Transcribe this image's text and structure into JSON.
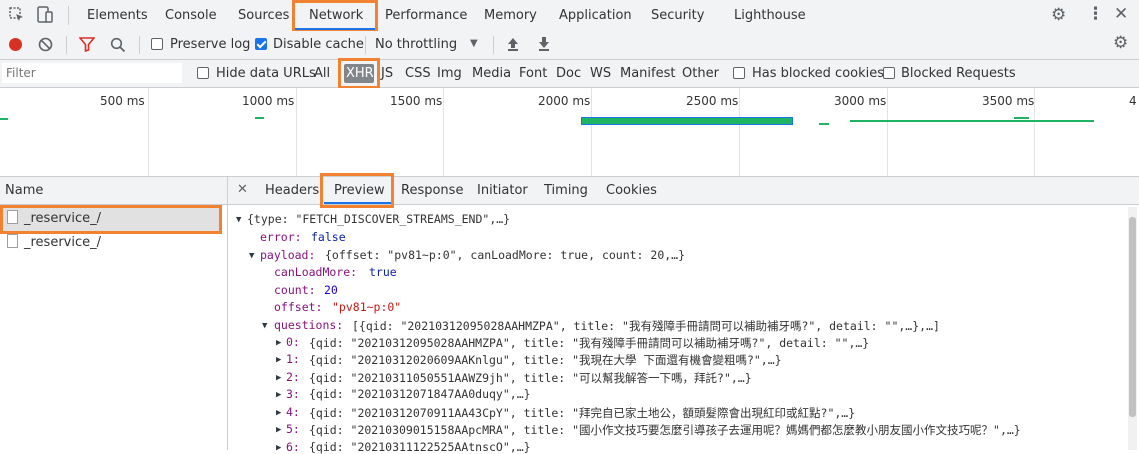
{
  "tabs": [
    "Elements",
    "Console",
    "Sources",
    "Network",
    "Performance",
    "Memory",
    "Application",
    "Security",
    "Lighthouse"
  ],
  "active_tab": "Network",
  "toolbar": {
    "preserve_log": "Preserve log",
    "disable_cache": "Disable cache",
    "throttling": "No throttling"
  },
  "filterbar": {
    "placeholder": "Filter",
    "hide_data_urls": "Hide data URLs",
    "types": [
      "All",
      "XHR",
      "JS",
      "CSS",
      "Img",
      "Media",
      "Font",
      "Doc",
      "WS",
      "Manifest",
      "Other"
    ],
    "active_type": "XHR",
    "has_blocked_cookies": "Has blocked cookies",
    "blocked_requests": "Blocked Requests"
  },
  "timeline": {
    "ticks": [
      "500 ms",
      "1000 ms",
      "1500 ms",
      "2000 ms",
      "2500 ms",
      "3000 ms",
      "3500 ms",
      "4"
    ]
  },
  "requests": {
    "header": "Name",
    "items": [
      "_reservice_/",
      "_reservice_/"
    ]
  },
  "detail_tabs": [
    "Headers",
    "Preview",
    "Response",
    "Initiator",
    "Timing",
    "Cookies"
  ],
  "active_detail_tab": "Preview",
  "preview": {
    "root": "{type: \"FETCH_DISCOVER_STREAMS_END\",…}",
    "error_key": "error:",
    "error_val": "false",
    "payload_key": "payload:",
    "payload_summary": "{offset: \"pv81~p:0\", canLoadMore: true, count: 20,…}",
    "canLoadMore_key": "canLoadMore:",
    "canLoadMore_val": "true",
    "count_key": "count:",
    "count_val": "20",
    "offset_key": "offset:",
    "offset_val": "\"pv81~p:0\"",
    "questions_key": "questions:",
    "questions_summary": "[{qid: \"20210312095028AAHMZPA\", title: \"我有殘障手冊請問可以補助補牙嗎?\", detail: \"\",…},…]",
    "items": [
      {
        "idx": "0:",
        "text": "{qid: \"20210312095028AAHMZPA\", title: \"我有殘障手冊請問可以補助補牙嗎?\", detail: \"\",…}"
      },
      {
        "idx": "1:",
        "text": "{qid: \"20210312020609AAKnlgu\", title: \"我現在大學 下面還有機會變粗嗎?\",…}"
      },
      {
        "idx": "2:",
        "text": "{qid: \"20210311050551AAWZ9jh\", title: \"可以幫我解答一下嗎，拜託?\",…}"
      },
      {
        "idx": "3:",
        "text": "{qid: \"20210312071847AA0duqy\",…}"
      },
      {
        "idx": "4:",
        "text": "{qid: \"20210312070911AA43CpY\", title: \"拜完自已家土地公，額頭髮際會出現紅印或紅點?\",…}"
      },
      {
        "idx": "5:",
        "text": "{qid: \"20210309015158AApcMRA\", title: \"國小作文技巧要怎麼引導孩子去運用呢？媽媽們都怎麼教小朋友國小作文技巧呢？\",…}"
      },
      {
        "idx": "6:",
        "text": "{qid: \"20210311122525AAtnscO\",…}"
      }
    ]
  }
}
